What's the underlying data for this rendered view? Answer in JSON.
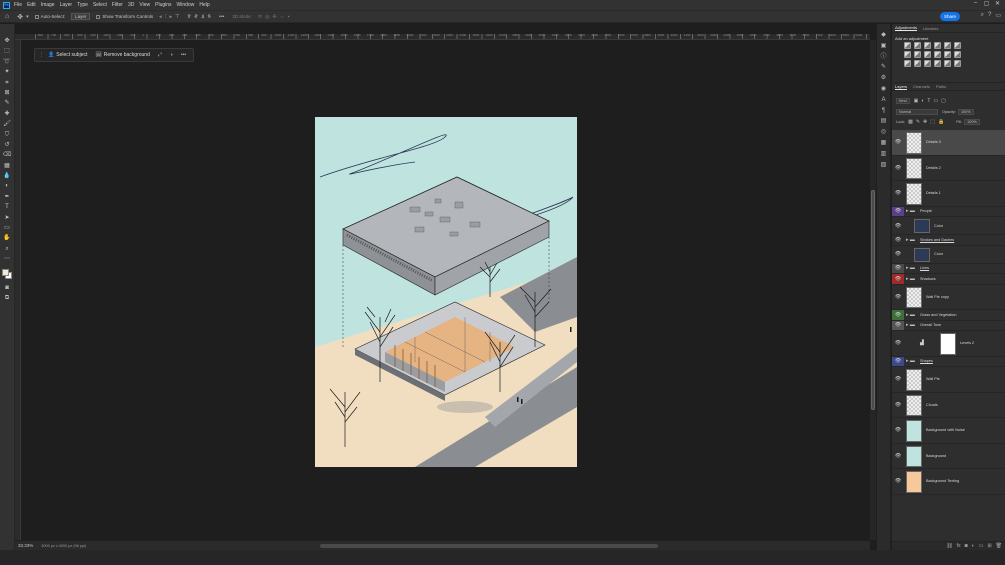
{
  "app": {
    "logo": "Ps",
    "menu": [
      "File",
      "Edit",
      "Image",
      "Layer",
      "Type",
      "Select",
      "Filter",
      "3D",
      "View",
      "Plugins",
      "Window",
      "Help"
    ]
  },
  "options": {
    "auto_select_label": "Auto-Select:",
    "auto_select_value": "Layer",
    "transform_label": "Show Transform Controls",
    "mode_3d": "3D Mode:",
    "share": "Share"
  },
  "ruler": {
    "ticks": [
      "-800",
      "-700",
      "-600",
      "-500",
      "-400",
      "-300",
      "-200",
      "-100",
      "0",
      "100",
      "200",
      "300",
      "400",
      "500",
      "600",
      "700",
      "800",
      "900",
      "1000",
      "1100",
      "1200",
      "1300",
      "1400",
      "1500",
      "1600",
      "1700",
      "1800",
      "1900",
      "2000",
      "2100",
      "2200",
      "2300",
      "2400",
      "2500",
      "2600",
      "2700",
      "2800",
      "2900",
      "3000",
      "3100",
      "3200",
      "3300",
      "3400",
      "3500",
      "3600",
      "3700",
      "3800",
      "3900",
      "4000",
      "4100",
      "4200",
      "4300",
      "4400",
      "4500",
      "4600",
      "4700",
      "4800",
      "4900",
      "5000",
      "5100",
      "5200",
      "5300",
      "5400"
    ]
  },
  "context_bar": {
    "select_subject": "Select subject",
    "remove_background": "Remove background"
  },
  "status": {
    "zoom": "33.33%",
    "doc_info": "3000 px x 4000 px (96 ppi)"
  },
  "panels": {
    "top_tabs": [
      "Adjustments",
      "Libraries"
    ],
    "adjust_title": "Add an adjustment",
    "layer_tabs": [
      "Layers",
      "Channels",
      "Paths"
    ],
    "kind": "Kind",
    "blend": "Normal",
    "opacity_label": "Opacity:",
    "opacity": "100%",
    "lock_label": "Lock:",
    "fill_label": "Fill:",
    "fill": "100%"
  },
  "layers": [
    {
      "name": "Details 3",
      "kind": "layer",
      "selected": true,
      "thumb": "checker"
    },
    {
      "name": "Details 2",
      "kind": "layer",
      "thumb": "checker"
    },
    {
      "name": "Details 1",
      "kind": "layer",
      "thumb": "checker"
    },
    {
      "name": "People",
      "kind": "group",
      "eye_color": "#5a3f8a"
    },
    {
      "name": "Color",
      "kind": "layer",
      "thumb": "#2d3a55",
      "indent": true
    },
    {
      "name": "Strokes and Dashes",
      "kind": "group",
      "underline": true
    },
    {
      "name": "Color",
      "kind": "layer",
      "thumb": "#2d3a55",
      "indent": true
    },
    {
      "name": "Lines",
      "kind": "group",
      "underline": true,
      "eye_color": "#4a4a4a"
    },
    {
      "name": "Shadows",
      "kind": "group",
      "eye_color": "#a02a2a"
    },
    {
      "name": "Wall Pie copy",
      "kind": "layer",
      "thumb": "checker"
    },
    {
      "name": "Grass and Vegetation",
      "kind": "group",
      "eye_color": "#3e6e3a"
    },
    {
      "name": "Overall Tone",
      "kind": "group",
      "eye_color": "#555"
    },
    {
      "name": "Levels 2",
      "kind": "adjustment",
      "thumb": "#ffffff"
    },
    {
      "name": "Shapes",
      "kind": "group",
      "underline": true,
      "eye_color": "#3a4a8a"
    },
    {
      "name": "Wall Pie",
      "kind": "layer",
      "thumb": "checker"
    },
    {
      "name": "Clouds",
      "kind": "layer",
      "thumb": "checker"
    },
    {
      "name": "Background with Noise",
      "kind": "layer",
      "thumb": "#bfe3df"
    },
    {
      "name": "Background",
      "kind": "layer",
      "thumb": "#bfe3df"
    },
    {
      "name": "Background Texting",
      "kind": "layer",
      "thumb": "#f7c99a"
    }
  ],
  "colors": {
    "accent": "#1473e6",
    "canvas_sky": "#bfe3df",
    "ground": "#f1dec0",
    "street": "#8a8d91",
    "building": "#b3b6ba",
    "foreground_swatch": "#f4e9d3"
  }
}
